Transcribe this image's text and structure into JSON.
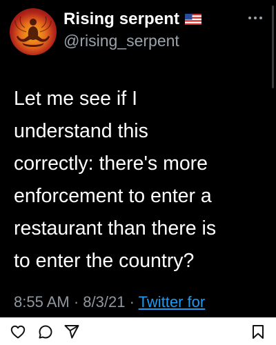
{
  "tweet": {
    "display_name": "Rising serpent",
    "handle": "@rising_serpent",
    "text_lines": [
      "Let me see if I",
      "understand this",
      "correctly: there's more",
      "enforcement to enter a",
      "restaurant than there is",
      "to enter the country?"
    ],
    "time": "8:55 AM",
    "date": "8/3/21",
    "separator": "·",
    "source": "Twitter for"
  },
  "icons": {
    "avatar": "meditating-figure-avatar",
    "flag": "us-flag-icon",
    "more": "more-options-icon",
    "like": "heart-icon",
    "comment": "comment-icon",
    "share": "send-icon",
    "save": "bookmark-icon"
  },
  "colors": {
    "card_background": "#000000",
    "text": "#ffffff",
    "secondary_text": "#9aa3ab",
    "link": "#1d9bf0",
    "action_bar": "#ffffff"
  }
}
